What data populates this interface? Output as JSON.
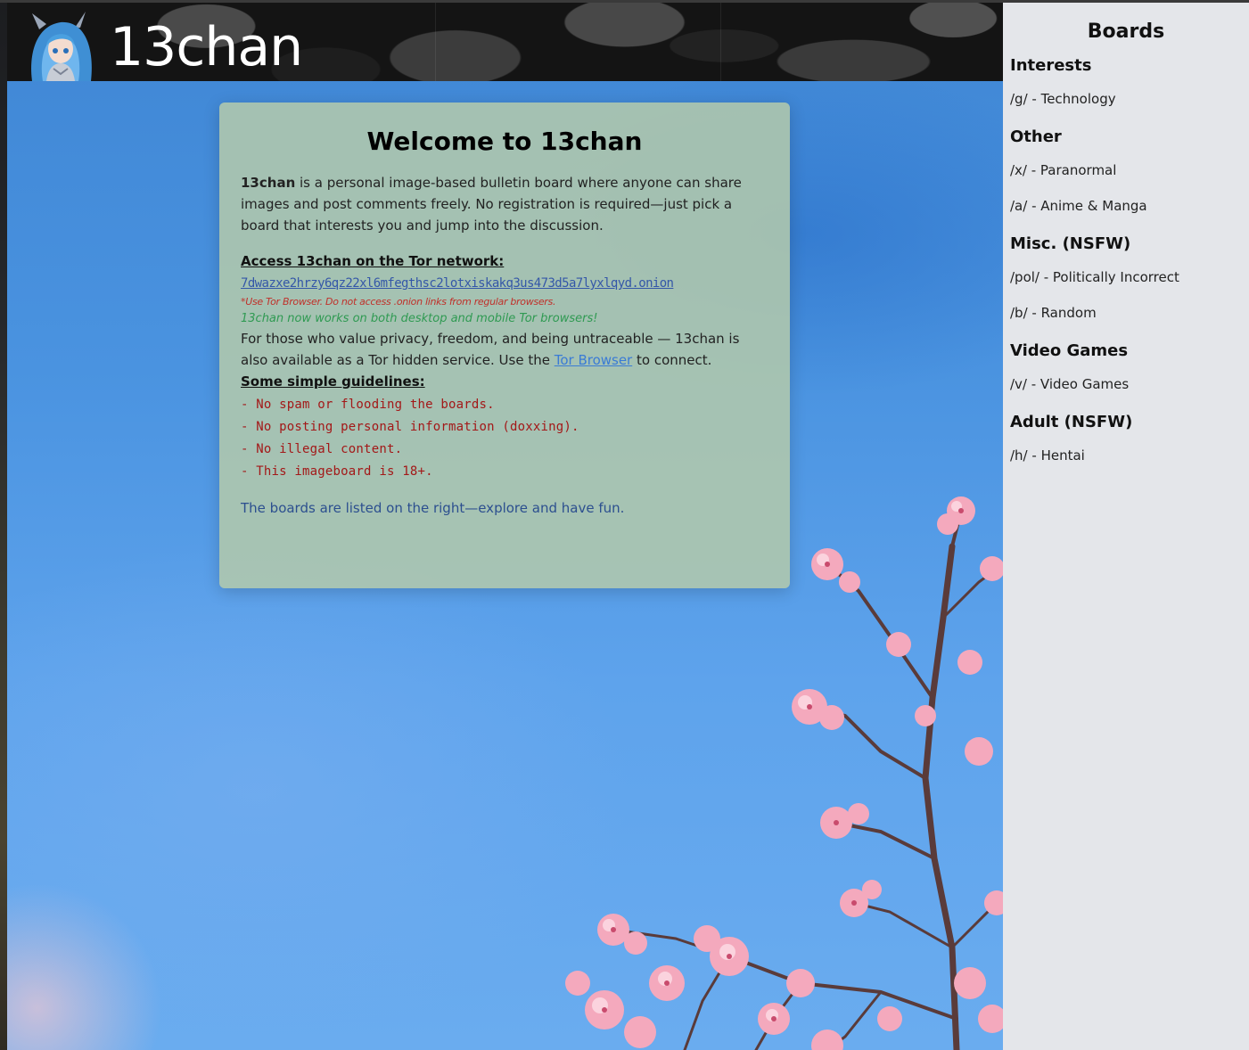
{
  "header": {
    "site_title": "13chan"
  },
  "welcome": {
    "title": "Welcome to 13chan",
    "intro_bold": "13chan",
    "intro_rest": " is a personal image-based bulletin board where anyone can share images and post comments freely. No registration is required—just pick a board that interests you and jump into the discussion.",
    "tor_heading": "Access 13chan on the Tor network:",
    "onion_address": "7dwazxe2hrzy6qz22xl6mfegthsc2lotxiskakq3us473d5a7lyxlqyd.onion",
    "tor_warning": "*Use Tor Browser. Do not access .onion links from regular browsers.",
    "mobile_note": "13chan now works on both desktop and mobile Tor browsers!",
    "privacy_before": "For those who value privacy, freedom, and being untraceable — 13chan is also available as a Tor hidden service. Use the ",
    "tor_browser_link": "Tor Browser",
    "privacy_after": " to connect.",
    "guidelines_heading": "Some simple guidelines:",
    "guidelines": [
      "- No spam or flooding the boards.",
      "- No posting personal information (doxxing).",
      "- No illegal content.",
      "- This imageboard is 18+."
    ],
    "closing": "The boards are listed on the right—explore and have fun."
  },
  "sidebar": {
    "title": "Boards",
    "categories": [
      {
        "name": "Interests",
        "boards": [
          "/g/ - Technology"
        ]
      },
      {
        "name": "Other",
        "boards": [
          "/x/ - Paranormal",
          "/a/ - Anime & Manga"
        ]
      },
      {
        "name": "Misc. (NSFW)",
        "boards": [
          "/pol/ - Politically Incorrect",
          "/b/ - Random"
        ]
      },
      {
        "name": "Video Games",
        "boards": [
          "/v/ - Video Games"
        ]
      },
      {
        "name": "Adult (NSFW)",
        "boards": [
          "/h/ - Hentai"
        ]
      }
    ]
  },
  "colors": {
    "sidebar_bg": "#e4e6ea",
    "card_bg": "#b2c8ac",
    "rule_red": "#a31818",
    "mobile_green": "#2f9a52",
    "link_blue": "#3a7bd5"
  },
  "icons": {
    "logo": "anime-mascot-logo"
  }
}
